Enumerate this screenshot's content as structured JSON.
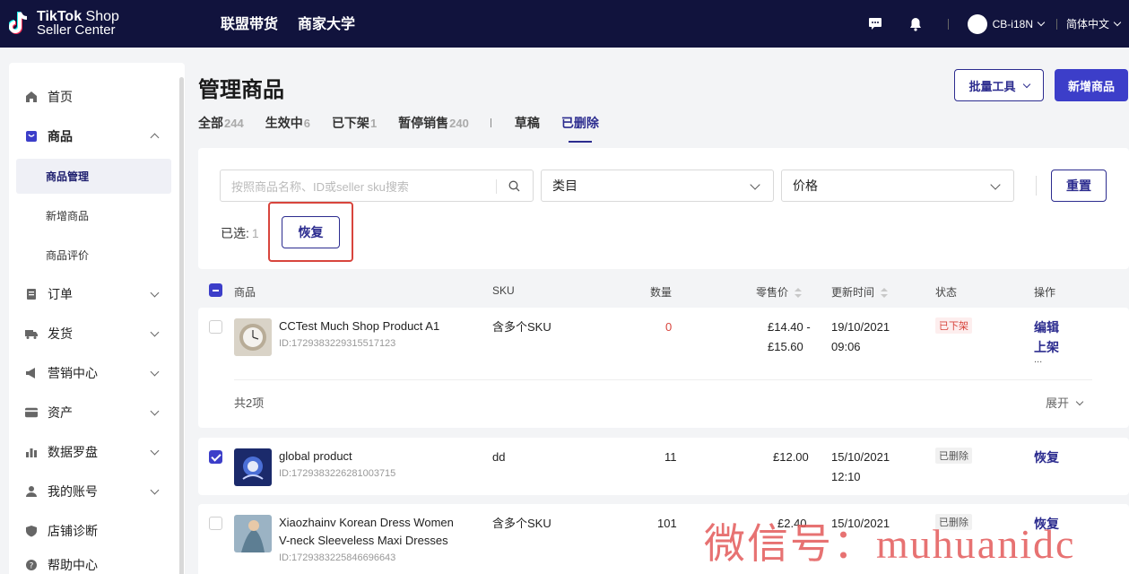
{
  "topbar": {
    "logo_line1_bold": "TikTok",
    "logo_line1_rest": " Shop",
    "logo_line2": "Seller Center",
    "nav": [
      "联盟带货",
      "商家大学"
    ],
    "account": "CB-i18N",
    "language": "简体中文",
    "icons": [
      "chat-icon",
      "bell-icon"
    ]
  },
  "sidebar": {
    "items": [
      {
        "label": "首页",
        "icon": "home-icon"
      },
      {
        "label": "商品",
        "icon": "product-icon",
        "expanded": true
      },
      {
        "label": "订单",
        "icon": "order-icon"
      },
      {
        "label": "发货",
        "icon": "truck-icon"
      },
      {
        "label": "营销中心",
        "icon": "megaphone-icon"
      },
      {
        "label": "资产",
        "icon": "card-icon"
      },
      {
        "label": "数据罗盘",
        "icon": "chart-icon"
      },
      {
        "label": "我的账号",
        "icon": "user-icon"
      },
      {
        "label": "店铺诊断",
        "icon": "shield-icon"
      },
      {
        "label": "帮助中心",
        "icon": "help-icon"
      }
    ],
    "sub_items": [
      "商品管理",
      "新增商品",
      "商品评价"
    ]
  },
  "page": {
    "title": "管理商品",
    "batch_tools": "批量工具",
    "new_product": "新增商品"
  },
  "tabs": [
    {
      "label": "全部",
      "count": "244"
    },
    {
      "label": "生效中",
      "count": "6"
    },
    {
      "label": "已下架",
      "count": "1"
    },
    {
      "label": "暂停销售",
      "count": "240"
    },
    {
      "label": "草稿",
      "count": ""
    },
    {
      "label": "已删除",
      "count": "",
      "active": true
    }
  ],
  "filters": {
    "search_placeholder": "按照商品名称、ID或seller sku搜索",
    "category": "类目",
    "price": "价格",
    "reset": "重置"
  },
  "selection": {
    "label": "已选:",
    "count": "1",
    "restore": "恢复"
  },
  "table": {
    "headers": [
      "商品",
      "SKU",
      "数量",
      "零售价",
      "更新时间",
      "状态",
      "操作"
    ],
    "rows": [
      {
        "name": "CCTest Much Shop Product A1",
        "id": "ID:1729383229315517123",
        "sku": "含多个SKU",
        "qty": "0",
        "price1": "£14.40 -",
        "price2": "£15.60",
        "date": "19/10/2021",
        "time": "09:06",
        "status": "已下架",
        "action1": "编辑",
        "action2": "上架",
        "more": "...",
        "group_count": "共2项",
        "expand": "展开",
        "checked": false
      },
      {
        "name": "global product",
        "id": "ID:1729383226281003715",
        "sku": "dd",
        "qty": "11",
        "price1": "£12.00",
        "date": "15/10/2021",
        "time": "12:10",
        "status": "已删除",
        "action1": "恢复",
        "checked": true
      },
      {
        "name1": "Xiaozhainv Korean Dress Women",
        "name2": "V-neck Sleeveless Maxi Dresses",
        "id": "ID:1729383225846696643",
        "sku": "含多个SKU",
        "qty": "101",
        "price1": "£2.40",
        "date": "15/10/2021",
        "status": "已删除",
        "action1": "恢复",
        "checked": false
      }
    ]
  },
  "watermark": "微信号：muhuanidc",
  "colors": {
    "topbar": "#11133d",
    "primary": "#2c2c8f",
    "primary_fill": "#3c3ec9",
    "highlight": "#d8453d"
  }
}
